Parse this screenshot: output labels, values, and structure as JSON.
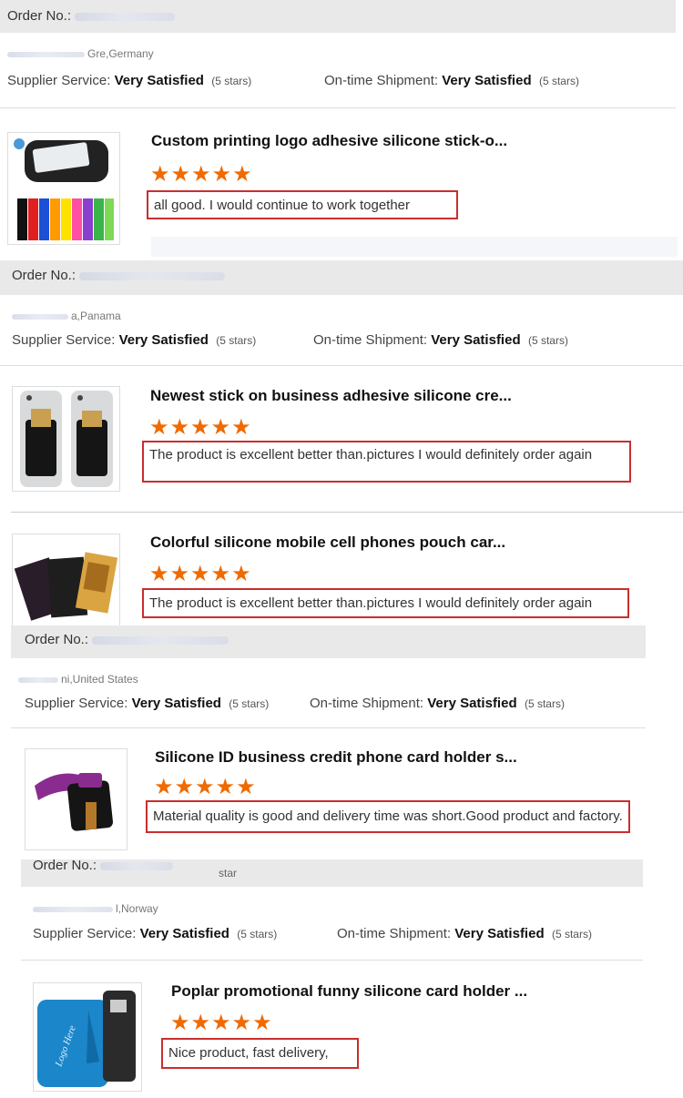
{
  "ratings": {
    "supplier_label": "Supplier Service:",
    "shipment_label": "On-time Shipment:",
    "value": "Very Satisfied",
    "stars_note": "(5 stars)"
  },
  "orders": [
    {
      "order_label": "Order No.:",
      "country": "Gre,Germany",
      "products": [
        {
          "title": "Custom printing logo adhesive silicone stick-o...",
          "stars": "★★★★★",
          "review": "all good. I would continue to work together"
        }
      ]
    },
    {
      "order_label": "Order No.:",
      "country": "a,Panama",
      "products": [
        {
          "title": "Newest stick on business adhesive silicone cre...",
          "stars": "★★★★★",
          "review": "The product is excellent better than.pictures I would definitely order again"
        },
        {
          "title": "Colorful silicone mobile cell phones pouch car...",
          "stars": "★★★★★",
          "review": "The product is excellent better than.pictures I would definitely order again"
        }
      ]
    },
    {
      "order_label": "Order No.:",
      "country": "ni,United States",
      "products": [
        {
          "title": "Silicone ID business credit phone card holder s...",
          "stars": "★★★★★",
          "review": "Material quality is good and delivery time was short.Good product and factory."
        }
      ]
    },
    {
      "order_label": "Order No.:",
      "order_suffix": "star",
      "country": "l,Norway",
      "products": [
        {
          "title": "Poplar promotional funny silicone card holder ...",
          "stars": "★★★★★",
          "review": "Nice product, fast delivery,"
        }
      ]
    }
  ]
}
